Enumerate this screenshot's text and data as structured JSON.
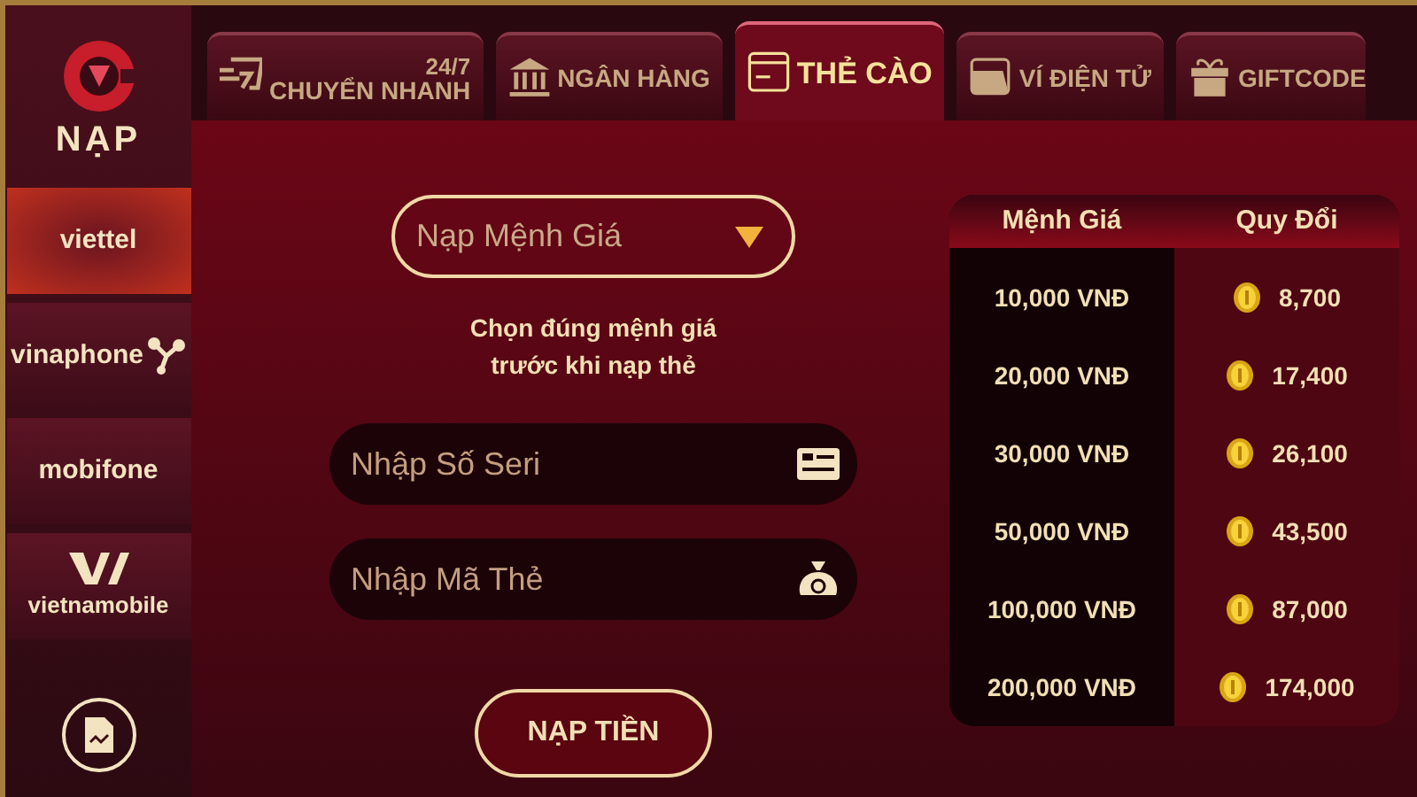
{
  "logo": {
    "label": "NẠP"
  },
  "tabs": [
    {
      "label": "CHUYỂN NHANH",
      "tag": "24/7",
      "selected": false
    },
    {
      "label": "NGÂN HÀNG",
      "selected": false
    },
    {
      "label": "THẺ CÀO",
      "selected": true
    },
    {
      "label": "VÍ ĐIỆN TỬ",
      "selected": false
    },
    {
      "label": "GIFTCODE",
      "selected": false
    }
  ],
  "operators": [
    {
      "label": "viettel",
      "selected": true
    },
    {
      "label": "vinaphone",
      "selected": false
    },
    {
      "label": "mobifone",
      "selected": false
    },
    {
      "label": "vietnamobile",
      "selected": false
    }
  ],
  "amount_select": {
    "placeholder": "Nạp Mệnh Giá"
  },
  "hint": "Chọn đúng mệnh giá\ntrước khi nạp thẻ",
  "serial_field": {
    "placeholder": "Nhập Số Seri"
  },
  "code_field": {
    "placeholder": "Nhập Mã Thẻ"
  },
  "submit_button": "NẠP TIỀN",
  "rate_table": {
    "columns": [
      "Mệnh Giá",
      "Quy Đổi"
    ],
    "rows": [
      [
        "10,000 VNĐ",
        "8,700"
      ],
      [
        "20,000 VNĐ",
        "17,400"
      ],
      [
        "30,000 VNĐ",
        "26,100"
      ],
      [
        "50,000 VNĐ",
        "43,500"
      ],
      [
        "100,000 VNĐ",
        "87,000"
      ],
      [
        "200,000 VNĐ",
        "174,000"
      ]
    ]
  }
}
